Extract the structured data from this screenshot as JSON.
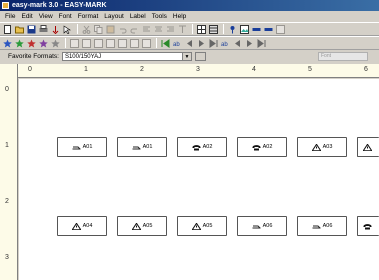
{
  "window": {
    "title": "easy-mark 3.0 - EASY-MARK"
  },
  "menu": [
    "File",
    "Edit",
    "View",
    "Font",
    "Format",
    "Layout",
    "Label",
    "Tools",
    "Help"
  ],
  "favorites": {
    "label": "Favorite Formats:",
    "value": "S100/150YAJ"
  },
  "font_box": {
    "text": "Font"
  },
  "ruler": {
    "h": [
      "0",
      "1",
      "2",
      "3",
      "4",
      "5",
      "6"
    ],
    "v": [
      "0",
      "1",
      "2",
      "3"
    ]
  },
  "labels": [
    {
      "icon": "hand-icon",
      "text": "A01"
    },
    {
      "icon": "hand-icon",
      "text": "A01"
    },
    {
      "icon": "phone-icon",
      "text": "A02"
    },
    {
      "icon": "phone-icon",
      "text": "A02"
    },
    {
      "icon": "warning-icon",
      "text": "A03"
    },
    {
      "icon": "warning-icon",
      "text": ""
    },
    {
      "icon": "warning-icon",
      "text": "A04"
    },
    {
      "icon": "warning-icon",
      "text": "A05"
    },
    {
      "icon": "warning-icon",
      "text": "A05"
    },
    {
      "icon": "hand-icon",
      "text": "A06"
    },
    {
      "icon": "hand-icon",
      "text": "A06"
    },
    {
      "icon": "phone-icon",
      "text": ""
    }
  ]
}
